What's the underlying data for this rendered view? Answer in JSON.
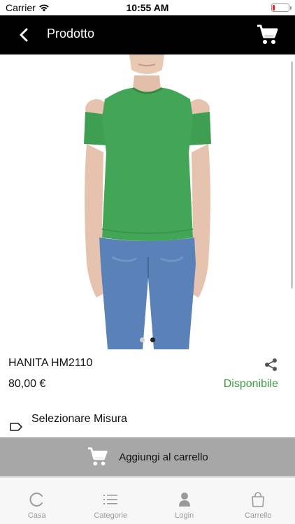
{
  "status_bar": {
    "carrier": "Carrier",
    "time": "10:55 AM",
    "battery_level": 0.08
  },
  "header": {
    "title": "Prodotto",
    "back_icon": "chevron-left-icon",
    "cart_icon": "cart-icon"
  },
  "product": {
    "image_alt": "Green t-shirt on model",
    "name": "HANITA HM2110",
    "price": "80,00 €",
    "availability": "Disponibile",
    "size_label": "Selezionare Misura",
    "carousel": {
      "count": 2,
      "active": 1
    }
  },
  "actions": {
    "add_to_cart": "Aggiungi al carrello"
  },
  "tabs": [
    {
      "label": "Casa",
      "icon": "refresh-icon"
    },
    {
      "label": "Categorie",
      "icon": "list-icon"
    },
    {
      "label": "Login",
      "icon": "user-icon"
    },
    {
      "label": "Carrello",
      "icon": "bag-icon"
    }
  ],
  "colors": {
    "header_bg": "#000000",
    "accent_green": "#3d9a43",
    "add_cart_bg": "#a7a7a7",
    "tab_inactive": "#9a9a9a"
  }
}
